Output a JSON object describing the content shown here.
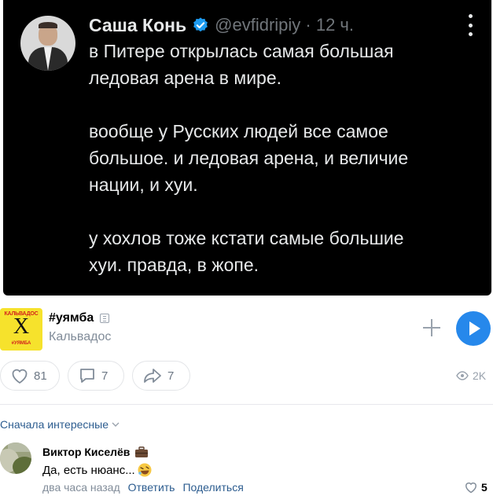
{
  "tweet": {
    "author_name": "Саша Конь",
    "handle_time": "@evfidripiy · 12 ч.",
    "paragraphs": [
      [
        "в Питере открылась самая большая",
        "ледовая арена в мире."
      ],
      [
        "вообще у Русских людей все самое",
        "большое. и ледовая арена, и величие",
        "нации, и хуи."
      ],
      [
        "у хохлов тоже кстати самые большие",
        "хуи. правда, в жопе."
      ]
    ]
  },
  "community": {
    "name": "#уямба",
    "subtitle": "Кальвадос",
    "logo": {
      "top_text": "КАЛЬВАДОС",
      "letter": "Х",
      "bottom_text": "#УЯМБА"
    }
  },
  "actions": {
    "likes": "81",
    "comments": "7",
    "shares": "7",
    "views": "2K"
  },
  "comments_section": {
    "sort_label": "Сначала интересные",
    "comment": {
      "author": "Виктор Киселёв",
      "text": "Да, есть нюанс...",
      "time": "два часа назад",
      "reply_label": "Ответить",
      "share_label": "Поделиться",
      "likes": "5"
    }
  },
  "colors": {
    "accent": "#2688eb",
    "link": "#2c5c8f",
    "muted": "#818c99",
    "verified": "#1d9bf0"
  }
}
